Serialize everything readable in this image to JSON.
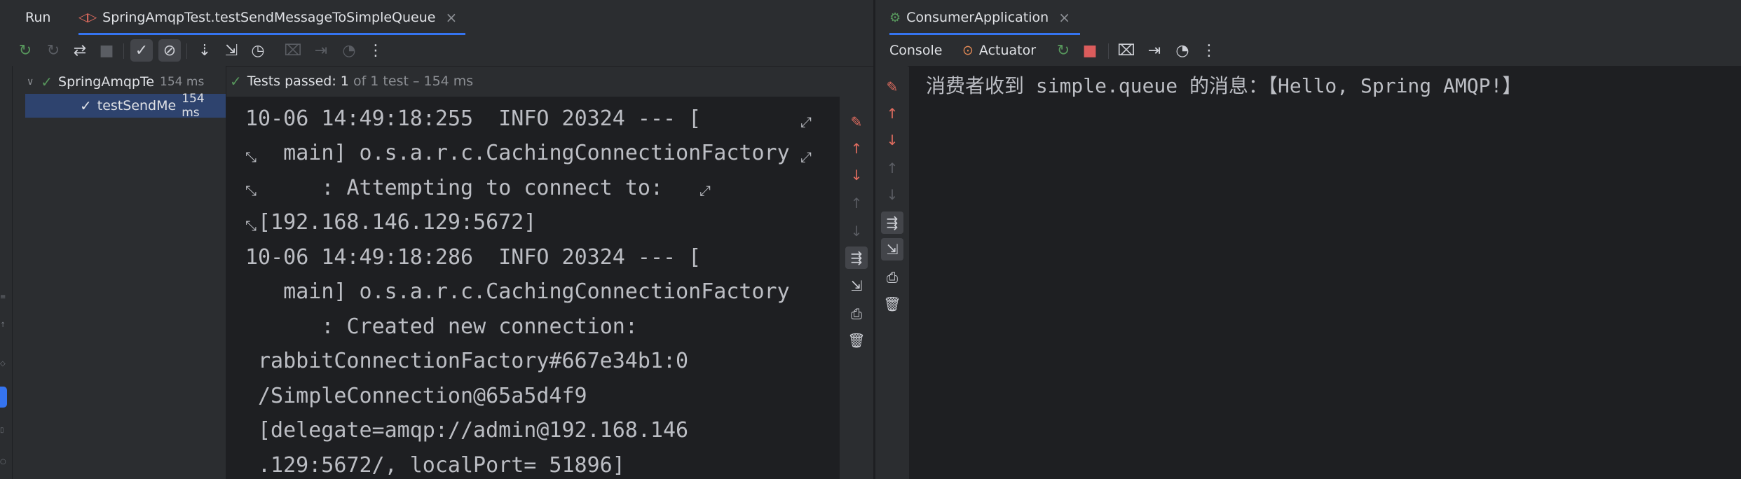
{
  "run_panel": {
    "title": "Run",
    "tab_label": "SpringAmqpTest.testSendMessageToSimpleQueue",
    "close_glyph": "×",
    "toolbar_icons": [
      "rerun-icon",
      "rerun-failed-icon",
      "toggle-auto-test-icon",
      "stop-icon",
      "show-passed-icon",
      "show-ignored-icon",
      "sort-alpha-icon",
      "sort-duration-icon",
      "history-icon",
      "screenshot-icon",
      "import-icon",
      "coverage-icon",
      "more-icon"
    ]
  },
  "test_tree": {
    "root_label": "SpringAmqpTe",
    "root_duration": "154 ms",
    "child_label": "testSendMe",
    "child_duration": "154 ms"
  },
  "test_status": {
    "passed_text": "Tests passed: 1",
    "detail_text": " of 1 test – 154 ms"
  },
  "console_left": {
    "lines": [
      "10-06 14:49:18:255  INFO 20324 --- [",
      "   main] o.s.a.r.c.CachingConnectionFactory",
      "      : Attempting to connect to:",
      "[192.168.146.129:5672]",
      "10-06 14:49:18:286  INFO 20324 --- [",
      "   main] o.s.a.r.c.CachingConnectionFactory",
      "      : Created new connection:",
      "rabbitConnectionFactory#667e34b1:0",
      "/SimpleConnection@65a5d4f9",
      "[delegate=amqp://admin@192.168.146",
      ".129:5672/, localPort= 51896]"
    ]
  },
  "consumer_panel": {
    "tab_label": "ConsumerApplication",
    "close_glyph": "×",
    "console_tab": "Console",
    "actuator_tab": "Actuator",
    "message": "消费者收到 simple.queue 的消息：【Hello, Spring AMQP!】"
  },
  "colors": {
    "accent": "#3574f0",
    "pass_green": "#57965c",
    "stop_red": "#db5c5c",
    "selection": "#2e436e"
  }
}
